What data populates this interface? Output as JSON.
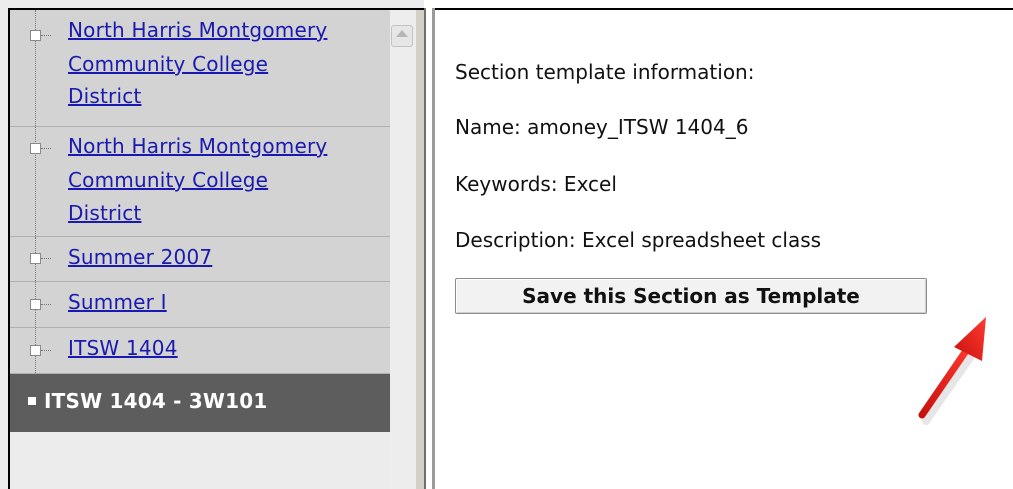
{
  "tree": {
    "items": [
      {
        "lines": [
          "North Harris Montgomery",
          "Community College",
          "District"
        ]
      },
      {
        "lines": [
          "North Harris Montgomery",
          "Community College",
          "District"
        ]
      },
      {
        "lines": [
          "Summer 2007"
        ]
      },
      {
        "lines": [
          "Summer I"
        ]
      },
      {
        "lines": [
          "ITSW 1404"
        ]
      }
    ],
    "selected_label": "ITSW 1404 - 3W101"
  },
  "section": {
    "heading": "Section template information:",
    "name": "Name: amoney_ITSW 1404_6",
    "keywords": "Keywords: Excel",
    "description": "Description: Excel spreadsheet class",
    "save_button_label": "Save this Section as Template"
  },
  "colors": {
    "link": "#1a1ab0",
    "selected_bg": "#5d5d5d",
    "annotation_arrow": "#e8201c"
  }
}
